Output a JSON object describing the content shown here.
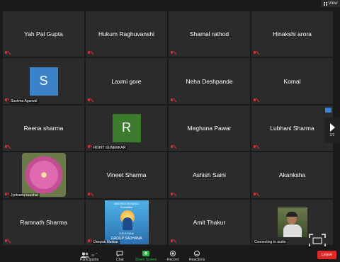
{
  "view_label": "View",
  "tiles": [
    {
      "name": "Yah Pal Gupta"
    },
    {
      "name": "Hukum Raghuvanshi"
    },
    {
      "name": "Shamal rathod"
    },
    {
      "name": "Hinakshi arora"
    },
    {
      "label": "Sushma Agarwal",
      "avatar": "S",
      "avatar_color": "#3b82c8"
    },
    {
      "name": "Laxmi gore"
    },
    {
      "name": "Neha Deshpande"
    },
    {
      "name": "Komal"
    },
    {
      "name": "Reena sharma"
    },
    {
      "label": "ROHIT GUNERKAR",
      "avatar": "R",
      "avatar_color": "#3c7a2e"
    },
    {
      "name": "Meghana Pawar"
    },
    {
      "name": "Lubhani Sharma"
    },
    {
      "label": "Jyotsana kaushal",
      "image": "flower"
    },
    {
      "name": "Vineet Sharma"
    },
    {
      "name": "Ashish Saini"
    },
    {
      "name": "Akanksha"
    },
    {
      "name": "Ramnath Sharma"
    },
    {
      "label": "Deepak Makkar",
      "image": "poster",
      "poster_top": "MEETING ON SAHAJ",
      "poster_mid": "Foundation",
      "poster_bottom": "GROUP SADHANA",
      "poster_time": "6:30-8:00AM"
    },
    {
      "name": "Amit Thakur"
    },
    {
      "label": "Connecting to audio",
      "image": "photo"
    }
  ],
  "pager": "2/2",
  "toolbar": {
    "participants_label": "Participants",
    "participants_count": "48",
    "chat_label": "Chat",
    "share_label": "Share Screen",
    "record_label": "Record",
    "reactions_label": "Reactions",
    "leave_label": "Leave"
  },
  "colors": {
    "share": "#2fb34a",
    "leave": "#e02828",
    "mic_muted": "#d33"
  }
}
